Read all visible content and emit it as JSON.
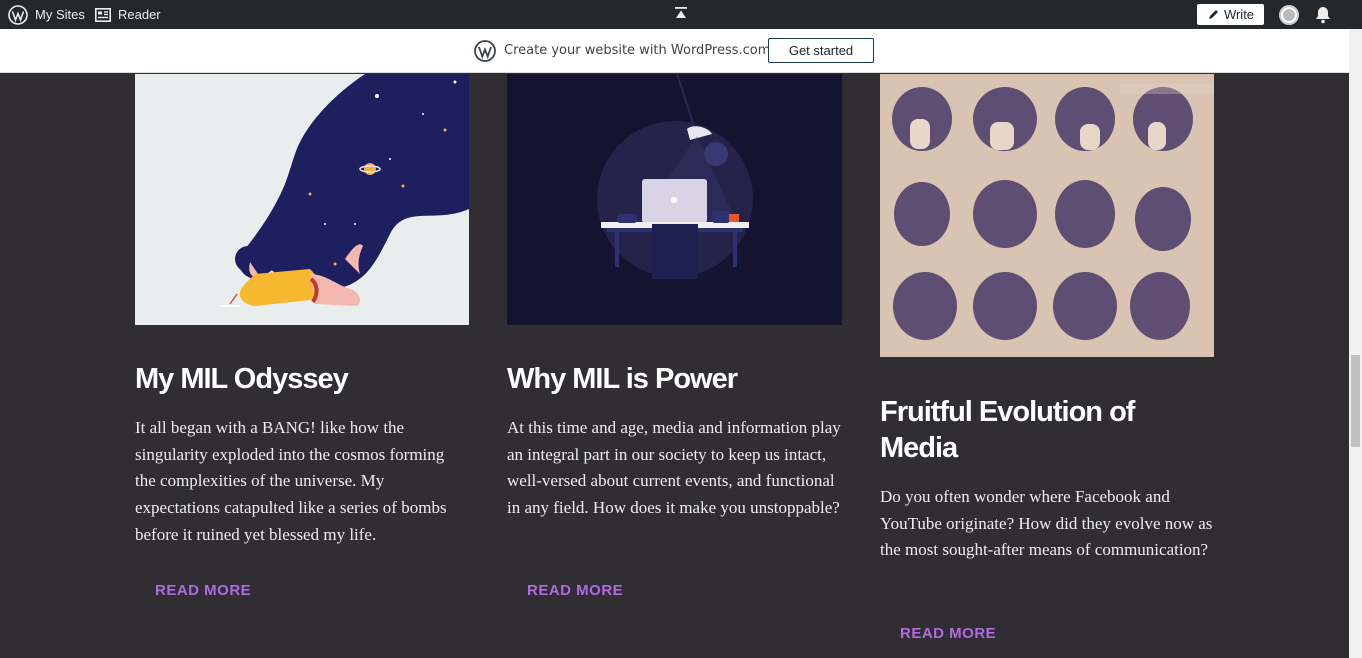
{
  "adminbar": {
    "mysites_label": "My Sites",
    "reader_label": "Reader",
    "write_label": "Write"
  },
  "banner": {
    "text": "Create your website with WordPress.com",
    "button_label": "Get started"
  },
  "posts": [
    {
      "title": "My MIL Odyssey",
      "excerpt": "It all began with a BANG! like how the singularity exploded into the cosmos forming the complexities of the universe. My expectations catapulted like a series of bombs before it ruined yet blessed my life.",
      "more": "READ MORE"
    },
    {
      "title": "Why MIL is Power",
      "excerpt": "At this time and age, media and information play an integral part in our society to keep us intact, well-versed about current events, and functional in any field. How does it make you unstoppable?",
      "more": "READ MORE"
    },
    {
      "title": "Fruitful Evolution of Media",
      "excerpt": "Do you often wonder where Facebook and YouTube originate? How did they evolve now as the most sought-after means of communication?",
      "more": "READ MORE"
    }
  ],
  "colors": {
    "background": "#302d33",
    "accent": "#b06be0",
    "adminbar": "#23282d"
  }
}
